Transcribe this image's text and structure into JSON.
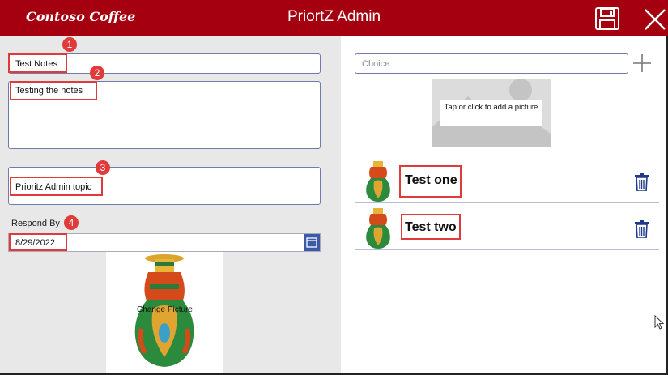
{
  "header": {
    "logo": "Contoso Coffee",
    "title": "PriortZ Admin",
    "bg_color": "#a4000f"
  },
  "form": {
    "title_value": "Test Notes",
    "description_value": "Testing the notes",
    "topic_value": "Prioritz Admin topic",
    "respond_by_label": "Respond By",
    "respond_by_value": "8/29/2022",
    "change_picture_label": "Change Picture"
  },
  "right_panel": {
    "choice_placeholder": "Choice",
    "picture_hint": "Tap or click to add a picture",
    "items": [
      {
        "name": "Test one"
      },
      {
        "name": "Test two"
      }
    ]
  },
  "callouts": [
    "1",
    "2",
    "3",
    "4"
  ],
  "icons": {
    "save": "save-icon",
    "close": "close-icon",
    "calendar": "calendar-icon",
    "add": "plus-icon",
    "delete": "trash-icon"
  },
  "colors": {
    "accent_blue": "#3d5aa8",
    "callout_red": "#e03b3b",
    "trash_blue": "#1f3a8a"
  }
}
